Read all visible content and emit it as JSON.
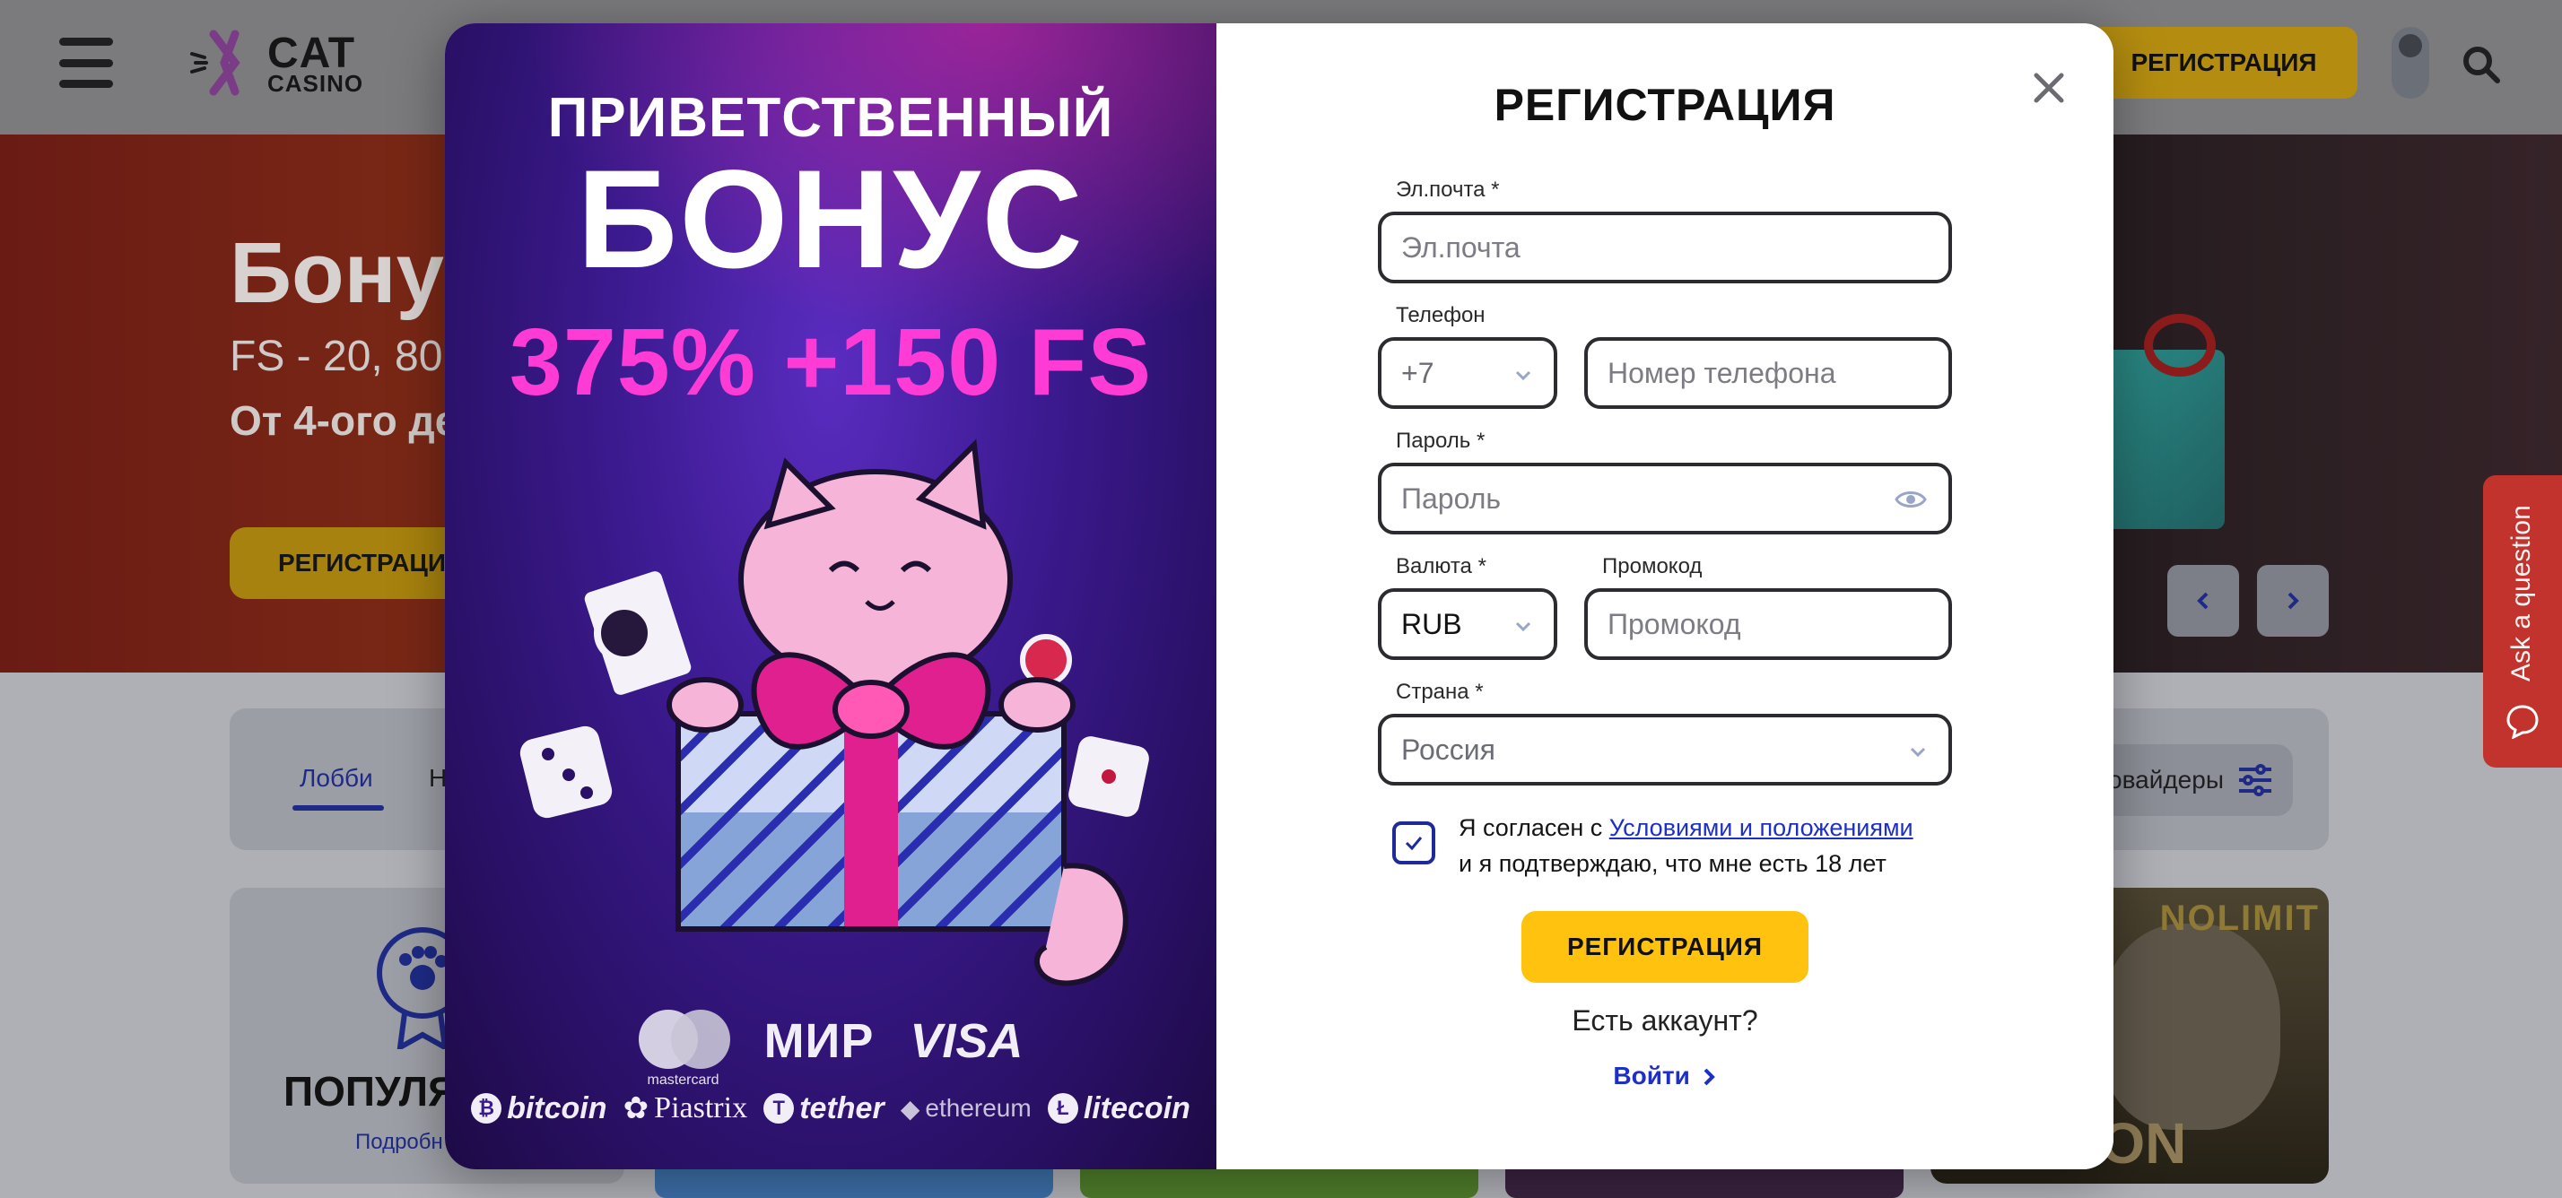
{
  "header": {
    "logo_line1": "CAT",
    "logo_line2": "CASINO",
    "register_label": "РЕГИСТРАЦИЯ"
  },
  "hero": {
    "title": "Бону",
    "subtitle1": "FS - 20, 80,",
    "subtitle2": "От 4-ого де",
    "cta_label": "РЕГИСТРАЦИ"
  },
  "tabs": {
    "lobby": "Лобби",
    "next": "Н",
    "providers": "овайдеры"
  },
  "popular": {
    "title": "ПОПУЛЯ",
    "more": "Подробн"
  },
  "games": {
    "nolimit": "NOLIMIT",
    "prison": "PRISON"
  },
  "ask": {
    "label": "Ask a question"
  },
  "promo": {
    "line1": "ПРИВЕТСТВЕННЫЙ",
    "line2": "БОНУС",
    "line3": "375% +150 FS",
    "payments_row1": {
      "mastercard": "mastercard",
      "mir": "МИР",
      "visa": "VISA"
    },
    "payments_row2": {
      "bitcoin": "bitcoin",
      "piastrix": "Piastrix",
      "tether": "tether",
      "ethereum": "ethereum",
      "litecoin": "litecoin"
    }
  },
  "form": {
    "title": "РЕГИСТРАЦИЯ",
    "email_label": "Эл.почта *",
    "email_placeholder": "Эл.почта",
    "phone_label": "Телефон",
    "phone_code": "+7",
    "phone_placeholder": "Номер телефона",
    "password_label": "Пароль *",
    "password_placeholder": "Пароль",
    "currency_label": "Валюта *",
    "currency_value": "RUB",
    "promo_label": "Промокод",
    "promo_placeholder": "Промокод",
    "country_label": "Страна *",
    "country_value": "Россия",
    "agree_prefix": "Я согласен с ",
    "agree_link": "Условиями и положениями",
    "agree_line2": "и я подтверждаю, что мне есть 18 лет",
    "agree_checked": true,
    "submit_label": "РЕГИСТРАЦИЯ",
    "have_account": "Есть аккаунт?",
    "login_label": "Войти"
  },
  "colors": {
    "accent_yellow": "#ffc20e",
    "link_blue": "#1e2fc5",
    "promo_pink": "#ff3bd5",
    "promo_purple": "#3b1a8f",
    "ask_red": "#c2332d"
  }
}
